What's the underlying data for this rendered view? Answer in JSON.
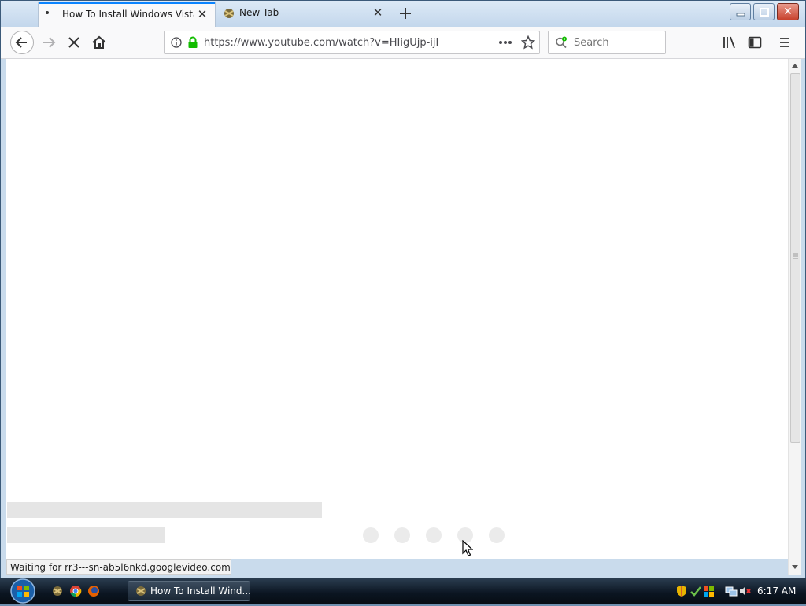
{
  "browser": {
    "tabs": [
      {
        "title": "How To Install Windows Vista E",
        "active": true
      },
      {
        "title": "New Tab",
        "active": false
      }
    ],
    "url": "https://www.youtube.com/watch?v=HIigUjp-ijI",
    "search_placeholder": "Search",
    "status_text": "Waiting for rr3---sn-ab5l6nkd.googlevideo.com..."
  },
  "taskbar": {
    "window_button_label": "How To Install Wind...",
    "clock": "6:17 AM"
  },
  "icons": {
    "tab_loading": "loading-dot-icon",
    "new_tab": "plus-icon",
    "back": "back-arrow-icon",
    "forward": "forward-arrow-icon",
    "stop": "stop-x-icon",
    "home": "home-icon",
    "site_info": "info-icon",
    "lock": "lock-icon",
    "page_actions": "more-dots-icon",
    "bookmark": "star-icon",
    "library": "library-icon",
    "sidebar": "sidebar-icon",
    "menu": "hamburger-menu-icon"
  },
  "colors": {
    "tab_accent": "#0a84ff",
    "lock_green": "#12bc00",
    "window_close": "#c8422d"
  }
}
